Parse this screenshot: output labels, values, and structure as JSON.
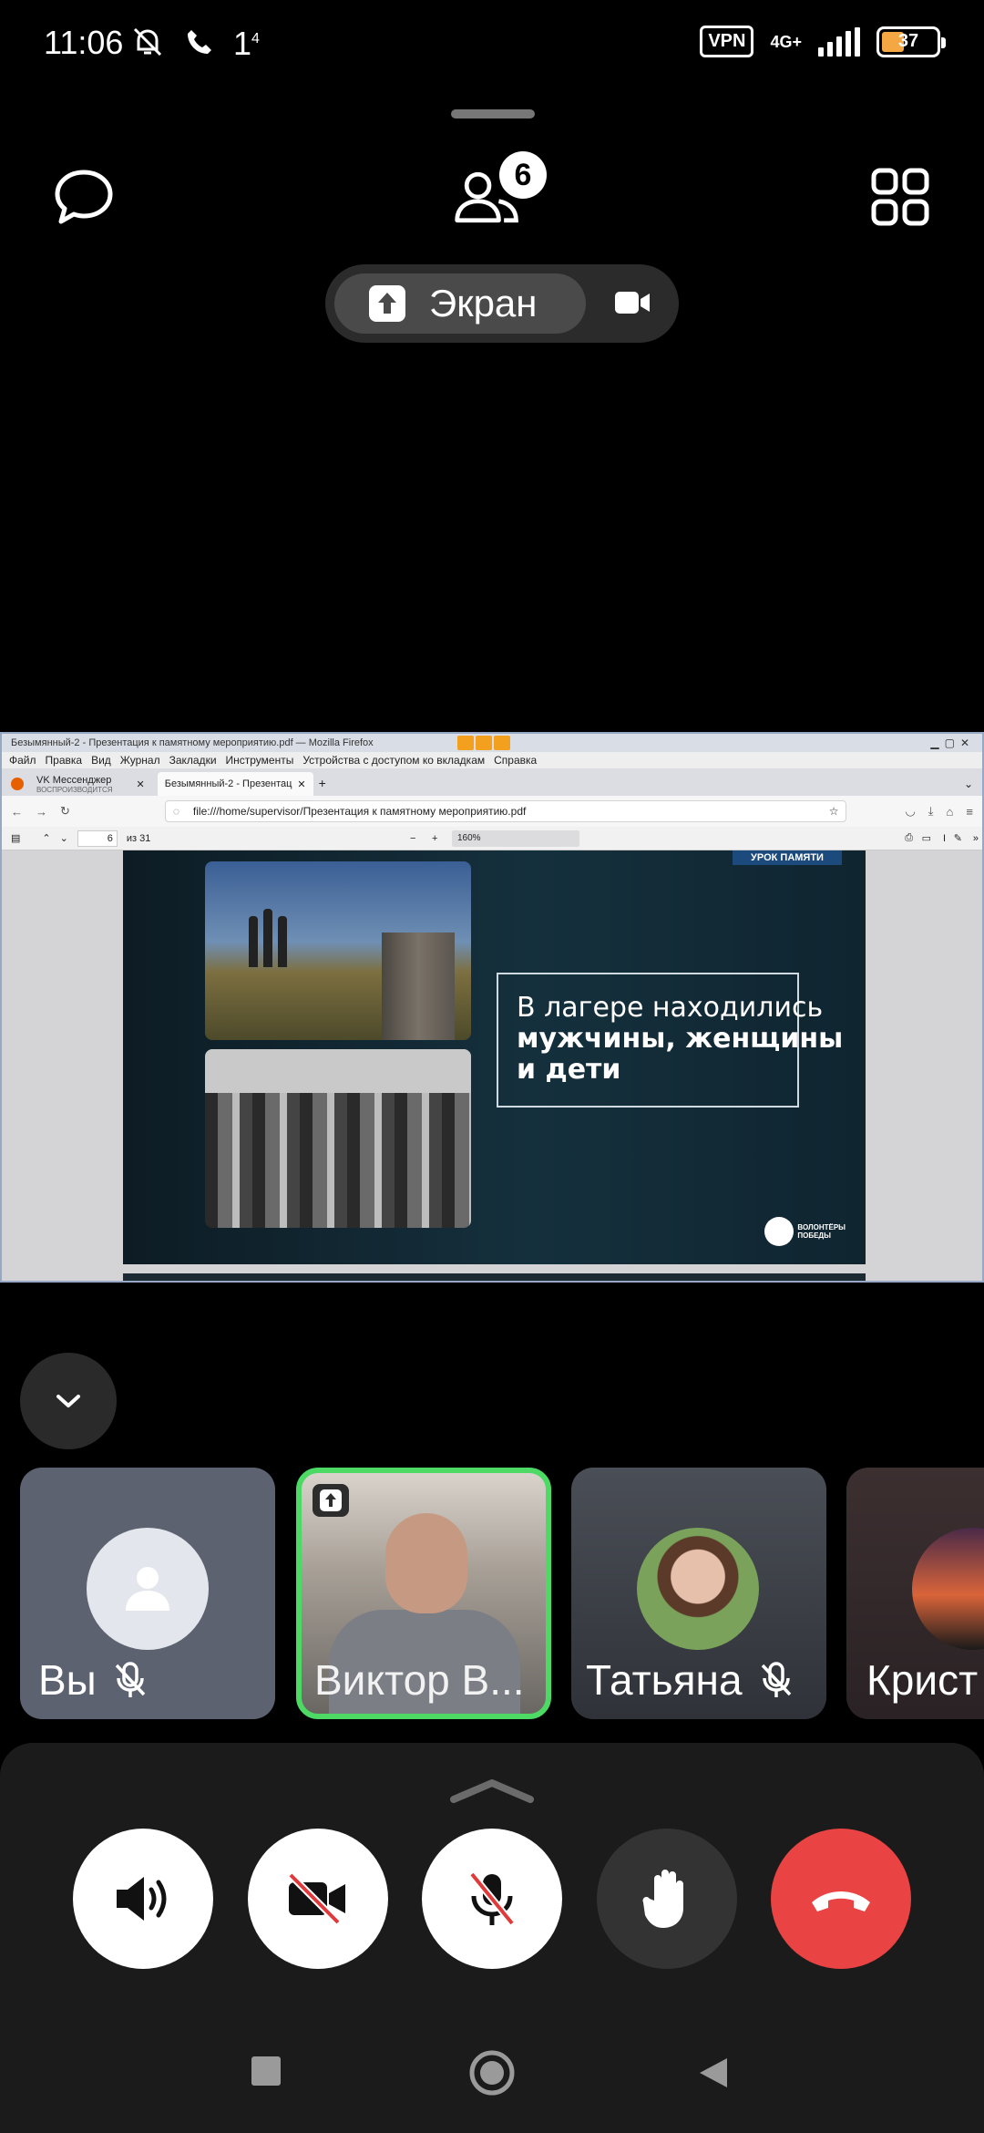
{
  "status_bar": {
    "time": "11:06",
    "sim": "1",
    "sim_sup": "4",
    "vpn": "VPN",
    "network": "4G+",
    "battery": "37"
  },
  "call": {
    "participants_count": "6",
    "share_label": "Экран"
  },
  "shared_screen": {
    "window_title": "Безымянный-2 - Презентация к памятному мероприятию.pdf — Mozilla Firefox",
    "menu": [
      "Файл",
      "Правка",
      "Вид",
      "Журнал",
      "Закладки",
      "Инструменты",
      "Устройства с доступом ко вкладкам",
      "Справка"
    ],
    "tabs": [
      {
        "title": "VK Мессенджер",
        "subtitle": "ВОСПРОИЗВОДИТСЯ"
      },
      {
        "title": "Безымянный-2 - Презентац"
      }
    ],
    "url": "file:///home/supervisor/Презентация к памятному мероприятию.pdf",
    "page_number": "6",
    "page_total": "из 31",
    "zoom": "160%",
    "slide": {
      "tag": "УРОК ПАМЯТИ",
      "line1": "В лагере находились",
      "line2": "мужчины, женщины",
      "line3": "и дети",
      "logo_text1": "ВОЛОНТЁРЫ",
      "logo_text2": "ПОБЕДЫ"
    }
  },
  "participants": [
    {
      "name": "Вы",
      "muted": true
    },
    {
      "name": "Виктор В...",
      "muted": false,
      "sharing": true
    },
    {
      "name": "Татьяна",
      "muted": true
    },
    {
      "name": "Крист",
      "muted": false
    }
  ],
  "colors": {
    "active_speaker": "#4cd964",
    "end_call": "#ea4343",
    "battery_fill": "#f4a742"
  }
}
